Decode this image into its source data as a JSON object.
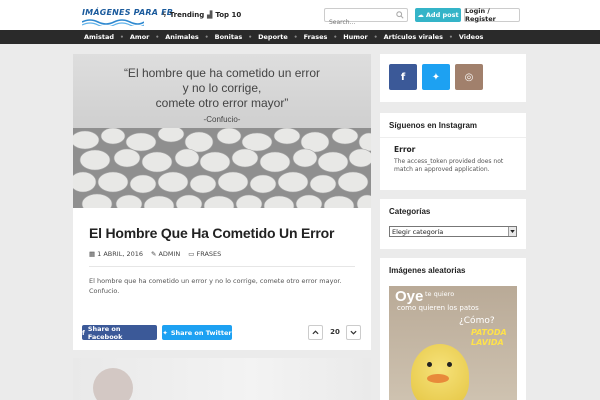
{
  "header": {
    "logo_text": "IMÁGENES PARA FB",
    "nav": [
      {
        "label": "Trending",
        "icon": "lightning-icon"
      },
      {
        "label": "Top 10",
        "icon": "bar-chart-icon"
      }
    ],
    "search_placeholder": "Search...",
    "add_post_label": "Add post",
    "login_label": "Login / Register"
  },
  "categories": [
    "Amistad",
    "Amor",
    "Animales",
    "Bonitas",
    "Deporte",
    "Frases",
    "Humor",
    "Artículos virales",
    "Videos"
  ],
  "post": {
    "quote_line1": "“El hombre que ha cometido un error",
    "quote_line2": "y no lo corrige,",
    "quote_line3": "comete otro error mayor”",
    "quote_author": "-Confucio-",
    "title": "El Hombre Que Ha Cometido Un Error",
    "date": "1 ABRIL, 2016",
    "author": "ADMIN",
    "category": "FRASES",
    "excerpt": "El hombre que ha cometido un error y no lo corrige, comete otro error mayor. Confucio.",
    "share_facebook": "Share on Facebook",
    "share_twitter": "Share on Twitter",
    "votes": "20"
  },
  "sidebar": {
    "social": [
      {
        "name": "facebook",
        "color": "#3b5998",
        "glyph": "f"
      },
      {
        "name": "twitter",
        "color": "#1da1f2",
        "glyph": "t"
      },
      {
        "name": "instagram",
        "color": "#a1806c",
        "glyph": "◎"
      }
    ],
    "instagram_title": "Síguenos en Instagram",
    "instagram_error_title": "Error",
    "instagram_error_msg": "The access_token provided does not match an approved application.",
    "categories_title": "Categorías",
    "categories_select": "Elegir categoría",
    "random_title": "Imágenes aleatorias",
    "random_img": {
      "oye": "Oye",
      "t1": "te quiero",
      "t2": "como quieren los patos",
      "t3": "¿Cómo?",
      "t4": "PATODA",
      "t5": "LAVIDA"
    }
  },
  "colors": {
    "nav_bg": "#2a2a2a",
    "accent": "#34b4c8",
    "facebook": "#3b5998",
    "twitter": "#1da1f2"
  }
}
